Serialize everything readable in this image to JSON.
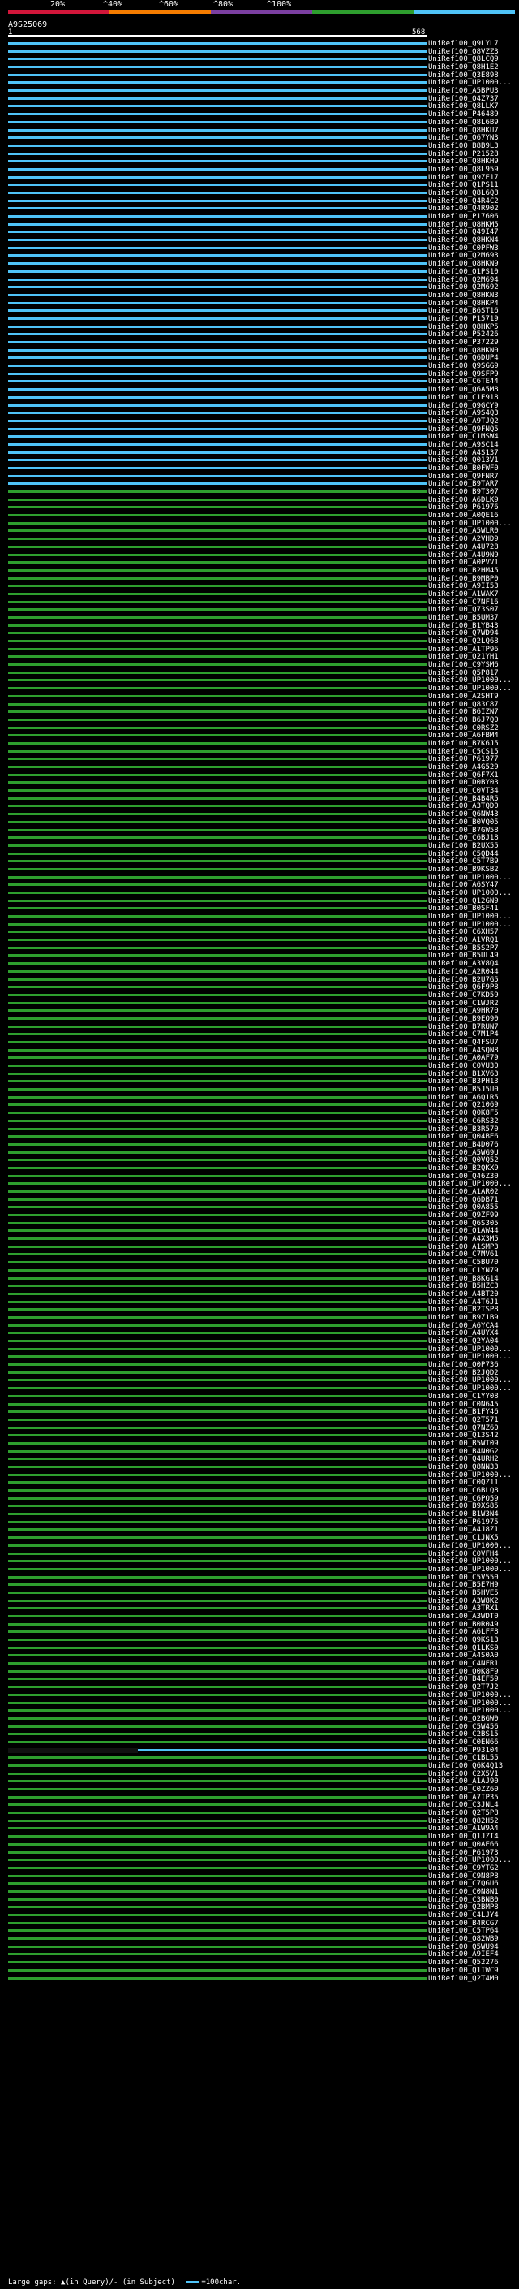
{
  "legend": {
    "marks": [
      "20%",
      "^40%",
      "^60%",
      "^80%",
      "^100%"
    ],
    "colors": [
      "#d2163a",
      "#f57c00",
      "#7b3fa0",
      "#2e9e2e",
      "#4fc3f7"
    ]
  },
  "query": {
    "id": "A9S25069",
    "start": "1",
    "end": "568"
  },
  "hits": [
    {
      "id": "UniRef100_Q9LYL7",
      "c": "blue"
    },
    {
      "id": "UniRef100_Q8VZZ3",
      "c": "blue"
    },
    {
      "id": "UniRef100_Q8LCQ9",
      "c": "blue"
    },
    {
      "id": "UniRef100_Q8H1E2",
      "c": "blue"
    },
    {
      "id": "UniRef100_Q3E898",
      "c": "blue"
    },
    {
      "id": "UniRef100_UP1000...",
      "c": "blue"
    },
    {
      "id": "UniRef100_A5BPU3",
      "c": "blue"
    },
    {
      "id": "UniRef100_Q4Z737",
      "c": "blue"
    },
    {
      "id": "UniRef100_Q8LLK7",
      "c": "blue"
    },
    {
      "id": "UniRef100_P46489",
      "c": "blue"
    },
    {
      "id": "UniRef100_Q8L6B9",
      "c": "blue"
    },
    {
      "id": "UniRef100_Q8HKU7",
      "c": "blue"
    },
    {
      "id": "UniRef100_Q67YN3",
      "c": "blue"
    },
    {
      "id": "UniRef100_B8B9L3",
      "c": "blue"
    },
    {
      "id": "UniRef100_P21528",
      "c": "blue"
    },
    {
      "id": "UniRef100_Q8HKH9",
      "c": "blue"
    },
    {
      "id": "UniRef100_Q8L959",
      "c": "blue"
    },
    {
      "id": "UniRef100_Q9ZE17",
      "c": "blue"
    },
    {
      "id": "UniRef100_Q1PS11",
      "c": "blue"
    },
    {
      "id": "UniRef100_Q8L6Q8",
      "c": "blue"
    },
    {
      "id": "UniRef100_Q4R4C2",
      "c": "blue"
    },
    {
      "id": "UniRef100_Q4R902",
      "c": "blue"
    },
    {
      "id": "UniRef100_P17606",
      "c": "blue"
    },
    {
      "id": "UniRef100_Q8HKM5",
      "c": "blue"
    },
    {
      "id": "UniRef100_Q49I47",
      "c": "blue"
    },
    {
      "id": "UniRef100_Q8HKN4",
      "c": "blue"
    },
    {
      "id": "UniRef100_C0PFW3",
      "c": "blue"
    },
    {
      "id": "UniRef100_Q2M693",
      "c": "blue"
    },
    {
      "id": "UniRef100_Q8HKN9",
      "c": "blue"
    },
    {
      "id": "UniRef100_Q1PS10",
      "c": "blue"
    },
    {
      "id": "UniRef100_Q2M694",
      "c": "blue"
    },
    {
      "id": "UniRef100_Q2M692",
      "c": "blue"
    },
    {
      "id": "UniRef100_Q8HKN3",
      "c": "blue"
    },
    {
      "id": "UniRef100_Q8HKP4",
      "c": "blue"
    },
    {
      "id": "UniRef100_B6ST16",
      "c": "blue"
    },
    {
      "id": "UniRef100_P15719",
      "c": "blue"
    },
    {
      "id": "UniRef100_Q8HKP5",
      "c": "blue"
    },
    {
      "id": "UniRef100_P52426",
      "c": "blue"
    },
    {
      "id": "UniRef100_P37229",
      "c": "blue"
    },
    {
      "id": "UniRef100_Q8HKN0",
      "c": "blue"
    },
    {
      "id": "UniRef100_Q6DUP4",
      "c": "blue"
    },
    {
      "id": "UniRef100_Q9SGG9",
      "c": "blue"
    },
    {
      "id": "UniRef100_Q9SFP9",
      "c": "blue"
    },
    {
      "id": "UniRef100_C6TE44",
      "c": "blue"
    },
    {
      "id": "UniRef100_Q6A5M8",
      "c": "blue"
    },
    {
      "id": "UniRef100_C1E918",
      "c": "blue"
    },
    {
      "id": "UniRef100_Q9GCY9",
      "c": "blue"
    },
    {
      "id": "UniRef100_A9S4Q3",
      "c": "blue"
    },
    {
      "id": "UniRef100_A9TJQ2",
      "c": "blue"
    },
    {
      "id": "UniRef100_Q9FNQ5",
      "c": "blue"
    },
    {
      "id": "UniRef100_C1MSW4",
      "c": "blue"
    },
    {
      "id": "UniRef100_A9SC14",
      "c": "blue"
    },
    {
      "id": "UniRef100_A4S137",
      "c": "blue"
    },
    {
      "id": "UniRef100_Q013V1",
      "c": "blue"
    },
    {
      "id": "UniRef100_B0FWF0",
      "c": "blue"
    },
    {
      "id": "UniRef100_Q9FNR7",
      "c": "blue"
    },
    {
      "id": "UniRef100_B9TAR7",
      "c": "blue"
    },
    {
      "id": "UniRef100_B9T307",
      "c": "green"
    },
    {
      "id": "UniRef100_A6DLK9",
      "c": "green"
    },
    {
      "id": "UniRef100_P61976",
      "c": "green"
    },
    {
      "id": "UniRef100_A0QE16",
      "c": "green"
    },
    {
      "id": "UniRef100_UP1000...",
      "c": "green"
    },
    {
      "id": "UniRef100_A5WLR0",
      "c": "green"
    },
    {
      "id": "UniRef100_A2VHD9",
      "c": "green"
    },
    {
      "id": "UniRef100_A4U728",
      "c": "green"
    },
    {
      "id": "UniRef100_A4U9N9",
      "c": "green"
    },
    {
      "id": "UniRef100_A0PVV1",
      "c": "green"
    },
    {
      "id": "UniRef100_B2HM45",
      "c": "green"
    },
    {
      "id": "UniRef100_B9MBP0",
      "c": "green"
    },
    {
      "id": "UniRef100_A9II53",
      "c": "green"
    },
    {
      "id": "UniRef100_A1WAK7",
      "c": "green"
    },
    {
      "id": "UniRef100_C7NF16",
      "c": "green"
    },
    {
      "id": "UniRef100_Q73S07",
      "c": "green"
    },
    {
      "id": "UniRef100_B5UM37",
      "c": "green"
    },
    {
      "id": "UniRef100_B1YB43",
      "c": "green"
    },
    {
      "id": "UniRef100_Q7WD94",
      "c": "green"
    },
    {
      "id": "UniRef100_Q2LQ68",
      "c": "green"
    },
    {
      "id": "UniRef100_A1TP96",
      "c": "green"
    },
    {
      "id": "UniRef100_Q21YH1",
      "c": "green"
    },
    {
      "id": "UniRef100_C9YSM6",
      "c": "green"
    },
    {
      "id": "UniRef100_Q5P817",
      "c": "green"
    },
    {
      "id": "UniRef100_UP1000...",
      "c": "green"
    },
    {
      "id": "UniRef100_UP1000...",
      "c": "green"
    },
    {
      "id": "UniRef100_A2SHT9",
      "c": "green"
    },
    {
      "id": "UniRef100_Q83C87",
      "c": "green"
    },
    {
      "id": "UniRef100_B6IZN7",
      "c": "green"
    },
    {
      "id": "UniRef100_B6J7Q0",
      "c": "green"
    },
    {
      "id": "UniRef100_C0RSZ2",
      "c": "green"
    },
    {
      "id": "UniRef100_A6FBM4",
      "c": "green"
    },
    {
      "id": "UniRef100_B7K6J5",
      "c": "green"
    },
    {
      "id": "UniRef100_C5CS15",
      "c": "green"
    },
    {
      "id": "UniRef100_P61977",
      "c": "green"
    },
    {
      "id": "UniRef100_A4G529",
      "c": "green"
    },
    {
      "id": "UniRef100_Q6F7X1",
      "c": "green"
    },
    {
      "id": "UniRef100_D0BY03",
      "c": "green"
    },
    {
      "id": "UniRef100_C0VT34",
      "c": "green"
    },
    {
      "id": "UniRef100_B4B4R5",
      "c": "green"
    },
    {
      "id": "UniRef100_A3TQD0",
      "c": "green"
    },
    {
      "id": "UniRef100_Q6NW43",
      "c": "green"
    },
    {
      "id": "UniRef100_B0VQ05",
      "c": "green"
    },
    {
      "id": "UniRef100_B7GW58",
      "c": "green"
    },
    {
      "id": "UniRef100_C6BJ18",
      "c": "green"
    },
    {
      "id": "UniRef100_B2UX55",
      "c": "green"
    },
    {
      "id": "UniRef100_C5QD44",
      "c": "green"
    },
    {
      "id": "UniRef100_C5T7B9",
      "c": "green"
    },
    {
      "id": "UniRef100_B9KSB2",
      "c": "green"
    },
    {
      "id": "UniRef100_UP1000...",
      "c": "green"
    },
    {
      "id": "UniRef100_A6SY47",
      "c": "green"
    },
    {
      "id": "UniRef100_UP1000...",
      "c": "green"
    },
    {
      "id": "UniRef100_Q12GN9",
      "c": "green"
    },
    {
      "id": "UniRef100_B0SF41",
      "c": "green"
    },
    {
      "id": "UniRef100_UP1000...",
      "c": "green"
    },
    {
      "id": "UniRef100_UP1000...",
      "c": "green"
    },
    {
      "id": "UniRef100_C6XH57",
      "c": "green"
    },
    {
      "id": "UniRef100_A1VRQ1",
      "c": "green"
    },
    {
      "id": "UniRef100_B5S2P7",
      "c": "green"
    },
    {
      "id": "UniRef100_B5UL49",
      "c": "green"
    },
    {
      "id": "UniRef100_A3V8Q4",
      "c": "green"
    },
    {
      "id": "UniRef100_A2R044",
      "c": "green"
    },
    {
      "id": "UniRef100_B2U7G5",
      "c": "green"
    },
    {
      "id": "UniRef100_Q6F9P8",
      "c": "green"
    },
    {
      "id": "UniRef100_C7KD59",
      "c": "green"
    },
    {
      "id": "UniRef100_C1WJR2",
      "c": "green"
    },
    {
      "id": "UniRef100_A9HR70",
      "c": "green"
    },
    {
      "id": "UniRef100_B9EQ90",
      "c": "green"
    },
    {
      "id": "UniRef100_B7RUN7",
      "c": "green"
    },
    {
      "id": "UniRef100_C7M1P4",
      "c": "green"
    },
    {
      "id": "UniRef100_Q4FSU7",
      "c": "green"
    },
    {
      "id": "UniRef100_A4SQN8",
      "c": "green"
    },
    {
      "id": "UniRef100_A0AF79",
      "c": "green"
    },
    {
      "id": "UniRef100_C0VU30",
      "c": "green"
    },
    {
      "id": "UniRef100_B1XV63",
      "c": "green"
    },
    {
      "id": "UniRef100_B3PH13",
      "c": "green"
    },
    {
      "id": "UniRef100_B5J5U0",
      "c": "green"
    },
    {
      "id": "UniRef100_A6Q1R5",
      "c": "green"
    },
    {
      "id": "UniRef100_Q21069",
      "c": "green"
    },
    {
      "id": "UniRef100_Q0K8F5",
      "c": "green"
    },
    {
      "id": "UniRef100_C6RS32",
      "c": "green"
    },
    {
      "id": "UniRef100_B3R570",
      "c": "green"
    },
    {
      "id": "UniRef100_Q04BE6",
      "c": "green"
    },
    {
      "id": "UniRef100_B4D076",
      "c": "green"
    },
    {
      "id": "UniRef100_A5WG9U",
      "c": "green"
    },
    {
      "id": "UniRef100_Q0VQ52",
      "c": "green"
    },
    {
      "id": "UniRef100_B2QKX9",
      "c": "green"
    },
    {
      "id": "UniRef100_Q46Z30",
      "c": "green"
    },
    {
      "id": "UniRef100_UP1000...",
      "c": "green"
    },
    {
      "id": "UniRef100_A1AR02",
      "c": "green"
    },
    {
      "id": "UniRef100_Q6DB71",
      "c": "green"
    },
    {
      "id": "UniRef100_Q0A855",
      "c": "green"
    },
    {
      "id": "UniRef100_Q9ZF99",
      "c": "green"
    },
    {
      "id": "UniRef100_Q6S305",
      "c": "green"
    },
    {
      "id": "UniRef100_Q1AW44",
      "c": "green"
    },
    {
      "id": "UniRef100_A4X3M5",
      "c": "green"
    },
    {
      "id": "UniRef100_A1SMP3",
      "c": "green"
    },
    {
      "id": "UniRef100_C7MV61",
      "c": "green"
    },
    {
      "id": "UniRef100_C5BU70",
      "c": "green"
    },
    {
      "id": "UniRef100_C1YN79",
      "c": "green"
    },
    {
      "id": "UniRef100_B8KG14",
      "c": "green"
    },
    {
      "id": "UniRef100_B5HZC3",
      "c": "green"
    },
    {
      "id": "UniRef100_A4BT20",
      "c": "green"
    },
    {
      "id": "UniRef100_A4T6J1",
      "c": "green"
    },
    {
      "id": "UniRef100_B2TSP8",
      "c": "green"
    },
    {
      "id": "UniRef100_B9Z1B9",
      "c": "green"
    },
    {
      "id": "UniRef100_A6YCA4",
      "c": "green"
    },
    {
      "id": "UniRef100_A4UYX4",
      "c": "green"
    },
    {
      "id": "UniRef100_Q2YA04",
      "c": "green"
    },
    {
      "id": "UniRef100_UP1000...",
      "c": "green"
    },
    {
      "id": "UniRef100_UP1000...",
      "c": "green"
    },
    {
      "id": "UniRef100_Q0P736",
      "c": "green"
    },
    {
      "id": "UniRef100_B2JQD2",
      "c": "green"
    },
    {
      "id": "UniRef100_UP1000...",
      "c": "green"
    },
    {
      "id": "UniRef100_UP1000...",
      "c": "green"
    },
    {
      "id": "UniRef100_C1YY08",
      "c": "green"
    },
    {
      "id": "UniRef100_C0N645",
      "c": "green"
    },
    {
      "id": "UniRef100_B1FY46",
      "c": "green"
    },
    {
      "id": "UniRef100_Q2T571",
      "c": "green"
    },
    {
      "id": "UniRef100_Q7NZ60",
      "c": "green"
    },
    {
      "id": "UniRef100_Q13S42",
      "c": "green"
    },
    {
      "id": "UniRef100_B5WT09",
      "c": "green"
    },
    {
      "id": "UniRef100_B4N0G2",
      "c": "green"
    },
    {
      "id": "UniRef100_Q4URH2",
      "c": "green"
    },
    {
      "id": "UniRef100_Q8NN33",
      "c": "green"
    },
    {
      "id": "UniRef100_UP1000...",
      "c": "green"
    },
    {
      "id": "UniRef100_C0QZ11",
      "c": "green"
    },
    {
      "id": "UniRef100_C6BLQ8",
      "c": "green"
    },
    {
      "id": "UniRef100_C6PQ59",
      "c": "green"
    },
    {
      "id": "UniRef100_B9XS85",
      "c": "green"
    },
    {
      "id": "UniRef100_B1W3N4",
      "c": "green"
    },
    {
      "id": "UniRef100_P61975",
      "c": "green"
    },
    {
      "id": "UniRef100_A4J8Z1",
      "c": "green"
    },
    {
      "id": "UniRef100_C1JNX5",
      "c": "green"
    },
    {
      "id": "UniRef100_UP1000...",
      "c": "green"
    },
    {
      "id": "UniRef100_C0VFH4",
      "c": "green"
    },
    {
      "id": "UniRef100_UP1000...",
      "c": "green"
    },
    {
      "id": "UniRef100_UP1000...",
      "c": "green"
    },
    {
      "id": "UniRef100_C5V550",
      "c": "green"
    },
    {
      "id": "UniRef100_B5E7H9",
      "c": "green"
    },
    {
      "id": "UniRef100_B5HVE5",
      "c": "green"
    },
    {
      "id": "UniRef100_A3W8K2",
      "c": "green"
    },
    {
      "id": "UniRef100_A3TRX1",
      "c": "green"
    },
    {
      "id": "UniRef100_A3WDT0",
      "c": "green"
    },
    {
      "id": "UniRef100_B0R049",
      "c": "green"
    },
    {
      "id": "UniRef100_A6LFF8",
      "c": "green"
    },
    {
      "id": "UniRef100_Q9KS13",
      "c": "green"
    },
    {
      "id": "UniRef100_Q1LKS0",
      "c": "green"
    },
    {
      "id": "UniRef100_A4S0A0",
      "c": "green"
    },
    {
      "id": "UniRef100_C4NFR1",
      "c": "green"
    },
    {
      "id": "UniRef100_Q0K8F9",
      "c": "green"
    },
    {
      "id": "UniRef100_B4EF59",
      "c": "green"
    },
    {
      "id": "UniRef100_Q2T7J2",
      "c": "green"
    },
    {
      "id": "UniRef100_UP1000...",
      "c": "green"
    },
    {
      "id": "UniRef100_UP1000...",
      "c": "green"
    },
    {
      "id": "UniRef100_UP1000...",
      "c": "green"
    },
    {
      "id": "UniRef100_Q2BGW0",
      "c": "green"
    },
    {
      "id": "UniRef100_C5W456",
      "c": "green"
    },
    {
      "id": "UniRef100_C2BS15",
      "c": "green"
    },
    {
      "id": "UniRef100_C0EN66",
      "c": "green"
    },
    {
      "id": "UniRef100_P93104",
      "c": "black"
    },
    {
      "id": "UniRef100_C1BL55",
      "c": "green"
    },
    {
      "id": "UniRef100_Q6K4Q13",
      "c": "green"
    },
    {
      "id": "UniRef100_C2X5V1",
      "c": "green"
    },
    {
      "id": "UniRef100_A1AJ90",
      "c": "green"
    },
    {
      "id": "UniRef100_C0ZZ60",
      "c": "green"
    },
    {
      "id": "UniRef100_A7IP35",
      "c": "green"
    },
    {
      "id": "UniRef100_C3JNL4",
      "c": "green"
    },
    {
      "id": "UniRef100_Q2T5P8",
      "c": "green"
    },
    {
      "id": "UniRef100_Q82H52",
      "c": "green"
    },
    {
      "id": "UniRef100_A1W9A4",
      "c": "green"
    },
    {
      "id": "UniRef100_Q1JZI4",
      "c": "green"
    },
    {
      "id": "UniRef100_Q0AE66",
      "c": "green"
    },
    {
      "id": "UniRef100_P61973",
      "c": "green"
    },
    {
      "id": "UniRef100_UP1000...",
      "c": "green"
    },
    {
      "id": "UniRef100_C9YTG2",
      "c": "green"
    },
    {
      "id": "UniRef100_C9N8P8",
      "c": "green"
    },
    {
      "id": "UniRef100_C7QGU6",
      "c": "green"
    },
    {
      "id": "UniRef100_C0N8N1",
      "c": "green"
    },
    {
      "id": "UniRef100_C3BNB0",
      "c": "green"
    },
    {
      "id": "UniRef100_Q2BMP8",
      "c": "green"
    },
    {
      "id": "UniRef100_C4LJY4",
      "c": "green"
    },
    {
      "id": "UniRef100_B4RCG7",
      "c": "green"
    },
    {
      "id": "UniRef100_C5TP64",
      "c": "green"
    },
    {
      "id": "UniRef100_Q82WB9",
      "c": "green"
    },
    {
      "id": "UniRef100_Q5WU94",
      "c": "green"
    },
    {
      "id": "UniRef100_A9IEF4",
      "c": "green"
    },
    {
      "id": "UniRef100_Q52276",
      "c": "green"
    },
    {
      "id": "UniRef100_Q1IWC9",
      "c": "green"
    },
    {
      "id": "UniRef100_Q2T4M0",
      "c": "green"
    }
  ],
  "footer": {
    "text": "Large gaps: ▲(in Query)/- (in Subject)",
    "scale": "=100char."
  }
}
